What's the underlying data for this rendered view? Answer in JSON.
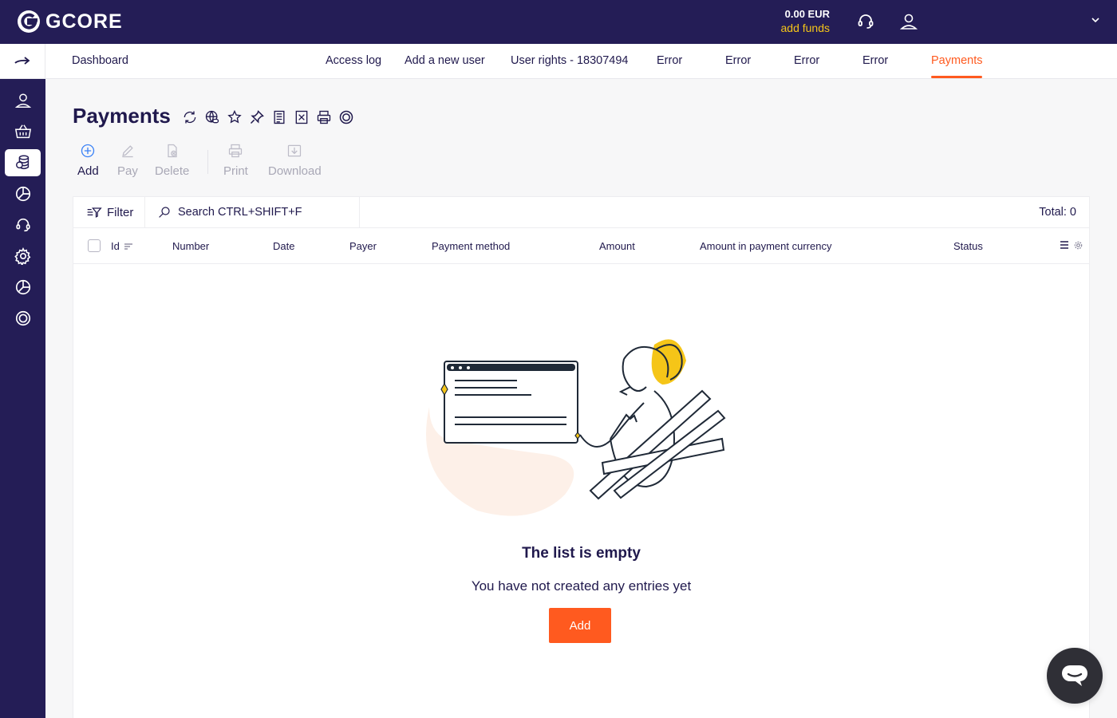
{
  "brand": {
    "name": "GCORE"
  },
  "balance": {
    "amount": "0.00 EUR",
    "link": "add funds"
  },
  "tabs": [
    {
      "label": "Dashboard",
      "active": false
    },
    {
      "label": "Access log",
      "active": false
    },
    {
      "label": "Add a new user",
      "active": false
    },
    {
      "label": "User rights - 18307494",
      "active": false
    },
    {
      "label": "Error",
      "active": false
    },
    {
      "label": "Error",
      "active": false
    },
    {
      "label": "Error",
      "active": false
    },
    {
      "label": "Error",
      "active": false
    },
    {
      "label": "Payments",
      "active": true
    }
  ],
  "sidebar": {
    "items": [
      {
        "icon": "user-icon"
      },
      {
        "icon": "basket-icon"
      },
      {
        "icon": "finance-icon",
        "active": true
      },
      {
        "icon": "pie-chart-icon"
      },
      {
        "icon": "headset-icon"
      },
      {
        "icon": "gear-icon"
      },
      {
        "icon": "pie-chart-icon"
      },
      {
        "icon": "lifebuoy-icon"
      }
    ]
  },
  "page": {
    "title": "Payments"
  },
  "title_icons": [
    "refresh-icon",
    "globe-link-icon",
    "star-icon",
    "pin-icon",
    "list-doc-icon",
    "excel-icon",
    "print-icon",
    "lifebuoy-icon"
  ],
  "toolbar": {
    "add": "Add",
    "pay": "Pay",
    "delete": "Delete",
    "print": "Print",
    "download": "Download"
  },
  "table": {
    "filter_label": "Filter",
    "search_placeholder": "Search CTRL+SHIFT+F",
    "total": "Total: 0",
    "columns": [
      "Id",
      "Number",
      "Date",
      "Payer",
      "Payment method",
      "Amount",
      "Amount in payment currency",
      "Status"
    ]
  },
  "empty": {
    "title": "The list is empty",
    "subtitle": "You have not created any entries yet",
    "button": "Add"
  },
  "colors": {
    "primary": "#241d56",
    "accent": "#ff5a1f",
    "highlight": "#f5c518"
  }
}
